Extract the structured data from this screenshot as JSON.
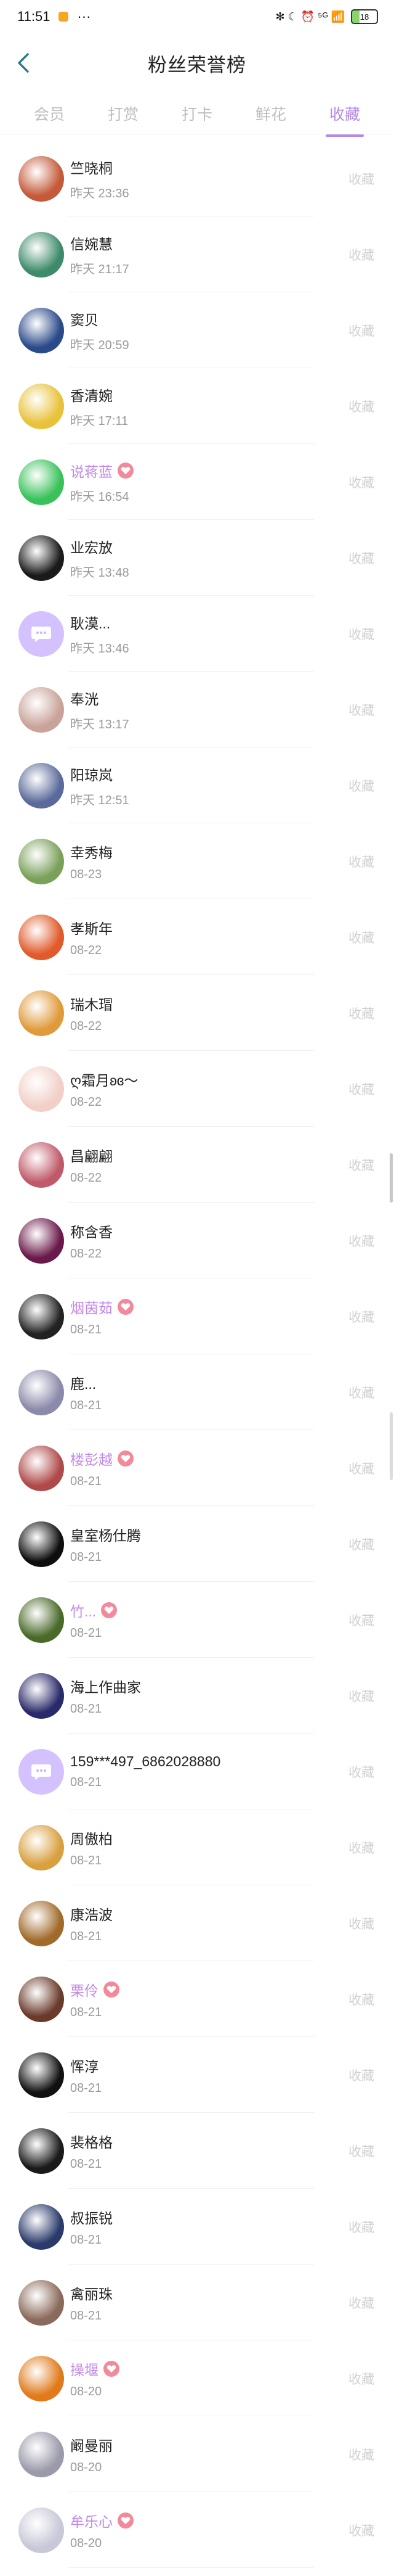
{
  "status_bar": {
    "time": "11:51",
    "dots": "···",
    "icons": "✻ ☾ ⏰ ⁵ᴳ 📶",
    "battery": "18"
  },
  "header": {
    "title": "粉丝荣誉榜",
    "back_icon": "chevron-left-icon"
  },
  "tabs": [
    {
      "label": "会员"
    },
    {
      "label": "打赏"
    },
    {
      "label": "打卡"
    },
    {
      "label": "鲜花"
    },
    {
      "label": "收藏"
    }
  ],
  "active_tab": 4,
  "action_label": "收藏",
  "fans": [
    {
      "name": "竺晓桐",
      "time": "昨天 23:36",
      "vip": false,
      "color": "#c45a3a"
    },
    {
      "name": "信婉慧",
      "time": "昨天 21:17",
      "vip": false,
      "color": "#3e8a6a"
    },
    {
      "name": "窦贝",
      "time": "昨天 20:59",
      "vip": false,
      "color": "#2a4a8a"
    },
    {
      "name": "香清婉",
      "time": "昨天 17:11",
      "vip": false,
      "color": "#e8c23a"
    },
    {
      "name": "说蒋蓝",
      "time": "昨天 16:54",
      "vip": true,
      "color": "#3ac25a"
    },
    {
      "name": "业宏放",
      "time": "昨天 13:48",
      "vip": false,
      "color": "#1a1a1a"
    },
    {
      "name": "耿漠...",
      "time": "昨天 13:46",
      "vip": false,
      "color": "placeholder"
    },
    {
      "name": "奉洸",
      "time": "昨天 13:17",
      "vip": false,
      "color": "#c9a39a"
    },
    {
      "name": "阳琼岚",
      "time": "昨天 12:51",
      "vip": false,
      "color": "#5a6a9a"
    },
    {
      "name": "幸秀梅",
      "time": "08-23",
      "vip": false,
      "color": "#7aa05a"
    },
    {
      "name": "孝斯年",
      "time": "08-22",
      "vip": false,
      "color": "#e05a2a"
    },
    {
      "name": "瑞木瑁",
      "time": "08-22",
      "vip": false,
      "color": "#e09a3a"
    },
    {
      "name": "ღ霜月ʚɞ～",
      "time": "08-22",
      "vip": false,
      "color": "#f2d0c8"
    },
    {
      "name": "昌翩翩",
      "time": "08-22",
      "vip": false,
      "color": "#c05a6a"
    },
    {
      "name": "称含香",
      "time": "08-22",
      "vip": false,
      "color": "#6a1a4a"
    },
    {
      "name": "烟茵茹",
      "time": "08-21",
      "vip": true,
      "color": "#222222"
    },
    {
      "name": "鹿...",
      "time": "08-21",
      "vip": false,
      "color": "#8a8aaa"
    },
    {
      "name": "楼彭越",
      "time": "08-21",
      "vip": true,
      "color": "#b04a4a"
    },
    {
      "name": "皇室杨仕腾",
      "time": "08-21",
      "vip": false,
      "color": "#0e0e0e"
    },
    {
      "name": "竹...",
      "time": "08-21",
      "vip": true,
      "color": "#4a6a2a"
    },
    {
      "name": "海上作曲家",
      "time": "08-21",
      "vip": false,
      "color": "#2a2a6a"
    },
    {
      "name": "159***497_6862028880",
      "time": "08-21",
      "vip": false,
      "color": "placeholder"
    },
    {
      "name": "周傲柏",
      "time": "08-21",
      "vip": false,
      "color": "#d8a040"
    },
    {
      "name": "康浩波",
      "time": "08-21",
      "vip": false,
      "color": "#a06a2a"
    },
    {
      "name": "栗伶",
      "time": "08-21",
      "vip": true,
      "color": "#6a3a2a"
    },
    {
      "name": "恽淳",
      "time": "08-21",
      "vip": false,
      "color": "#111111"
    },
    {
      "name": "裴格格",
      "time": "08-21",
      "vip": false,
      "color": "#1a1a1a"
    },
    {
      "name": "叔振锐",
      "time": "08-21",
      "vip": false,
      "color": "#2a3a6a"
    },
    {
      "name": "禽丽珠",
      "time": "08-21",
      "vip": false,
      "color": "#8a6a5a"
    },
    {
      "name": "操堰",
      "time": "08-20",
      "vip": true,
      "color": "#e07a1a"
    },
    {
      "name": "阚曼丽",
      "time": "08-20",
      "vip": false,
      "color": "#9a9aaa"
    },
    {
      "name": "牟乐心",
      "time": "08-20",
      "vip": true,
      "color": "#c8c8d8"
    }
  ]
}
